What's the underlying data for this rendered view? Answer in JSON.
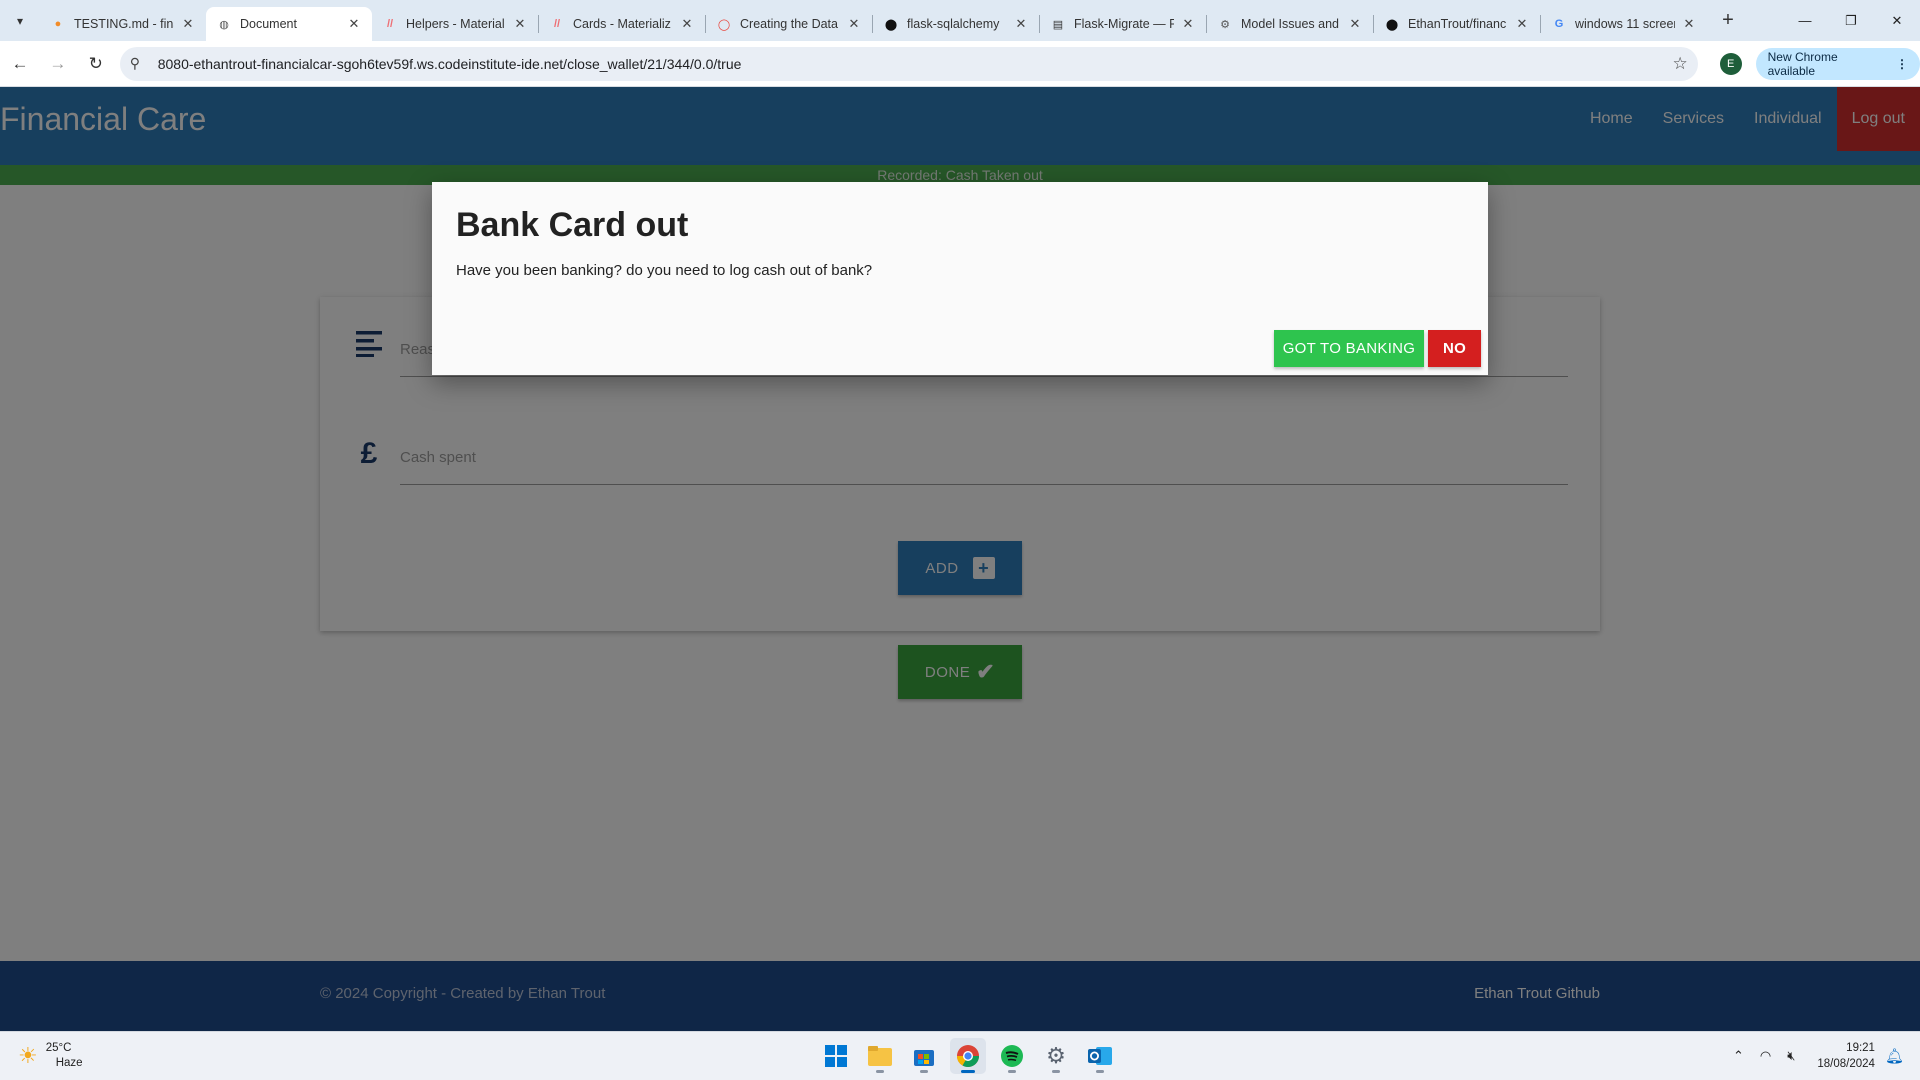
{
  "browser": {
    "tabs": [
      {
        "title": "TESTING.md - fina",
        "favicon": "orange-swirl-icon"
      },
      {
        "title": "Document",
        "favicon": "globe-icon",
        "active": true
      },
      {
        "title": "Helpers - Material",
        "favicon": "materialize-icon"
      },
      {
        "title": "Cards - Materializ",
        "favicon": "materialize-icon"
      },
      {
        "title": "Creating the Data",
        "favicon": "red-ring-icon"
      },
      {
        "title": "flask-sqlalchemy",
        "favicon": "github-icon"
      },
      {
        "title": "Flask-Migrate — F",
        "favicon": "doc-icon"
      },
      {
        "title": "Model Issues and",
        "favicon": "gear-icon"
      },
      {
        "title": "EthanTrout/financ",
        "favicon": "github-icon"
      },
      {
        "title": "windows 11 screen",
        "favicon": "google-icon"
      }
    ],
    "url": "8080-ethantrout-financialcar-sgoh6tev59f.ws.codeinstitute-ide.net/close_wallet/21/344/0.0/true",
    "profile_initial": "E",
    "update_label": "New Chrome available"
  },
  "site": {
    "brand": "Financial Care",
    "nav": {
      "home": "Home",
      "services": "Services",
      "individual": "Individual",
      "logout": "Log out"
    },
    "flash": "Recorded: Cash Taken out",
    "form": {
      "reason_placeholder": "Reason",
      "cash_placeholder": "Cash spent",
      "currency_symbol": "£",
      "add_label": "ADD",
      "done_label": "DONE"
    },
    "footer": {
      "copyright": "© 2024 Copyright - Created by Ethan Trout",
      "github": "Ethan Trout Github"
    }
  },
  "modal": {
    "title": "Bank Card out",
    "text": "Have you been banking? do you need to log cash out of bank?",
    "banking_label": "GOT TO BANKING",
    "no_label": "NO"
  },
  "taskbar": {
    "weather_temp": "25°C",
    "weather_desc": "Haze",
    "time": "19:21",
    "date": "18/08/2024"
  },
  "colors": {
    "nav_blue": "#2e7fbd",
    "logout_red": "#d32f2f",
    "flash_green": "#4caf50",
    "footer_blue": "#1f4c8f",
    "banking_green": "#2ec44e",
    "no_red": "#d41f1f"
  }
}
